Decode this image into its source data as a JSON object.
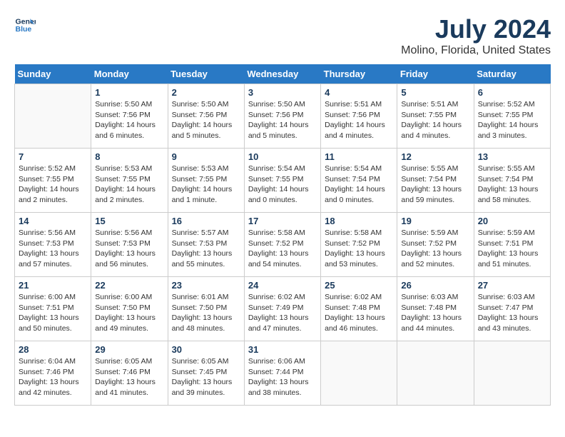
{
  "header": {
    "logo_line1": "General",
    "logo_line2": "Blue",
    "title": "July 2024",
    "subtitle": "Molino, Florida, United States"
  },
  "days_of_week": [
    "Sunday",
    "Monday",
    "Tuesday",
    "Wednesday",
    "Thursday",
    "Friday",
    "Saturday"
  ],
  "weeks": [
    [
      {
        "day": "",
        "info": ""
      },
      {
        "day": "1",
        "info": "Sunrise: 5:50 AM\nSunset: 7:56 PM\nDaylight: 14 hours\nand 6 minutes."
      },
      {
        "day": "2",
        "info": "Sunrise: 5:50 AM\nSunset: 7:56 PM\nDaylight: 14 hours\nand 5 minutes."
      },
      {
        "day": "3",
        "info": "Sunrise: 5:50 AM\nSunset: 7:56 PM\nDaylight: 14 hours\nand 5 minutes."
      },
      {
        "day": "4",
        "info": "Sunrise: 5:51 AM\nSunset: 7:56 PM\nDaylight: 14 hours\nand 4 minutes."
      },
      {
        "day": "5",
        "info": "Sunrise: 5:51 AM\nSunset: 7:55 PM\nDaylight: 14 hours\nand 4 minutes."
      },
      {
        "day": "6",
        "info": "Sunrise: 5:52 AM\nSunset: 7:55 PM\nDaylight: 14 hours\nand 3 minutes."
      }
    ],
    [
      {
        "day": "7",
        "info": "Sunrise: 5:52 AM\nSunset: 7:55 PM\nDaylight: 14 hours\nand 2 minutes."
      },
      {
        "day": "8",
        "info": "Sunrise: 5:53 AM\nSunset: 7:55 PM\nDaylight: 14 hours\nand 2 minutes."
      },
      {
        "day": "9",
        "info": "Sunrise: 5:53 AM\nSunset: 7:55 PM\nDaylight: 14 hours\nand 1 minute."
      },
      {
        "day": "10",
        "info": "Sunrise: 5:54 AM\nSunset: 7:55 PM\nDaylight: 14 hours\nand 0 minutes."
      },
      {
        "day": "11",
        "info": "Sunrise: 5:54 AM\nSunset: 7:54 PM\nDaylight: 14 hours\nand 0 minutes."
      },
      {
        "day": "12",
        "info": "Sunrise: 5:55 AM\nSunset: 7:54 PM\nDaylight: 13 hours\nand 59 minutes."
      },
      {
        "day": "13",
        "info": "Sunrise: 5:55 AM\nSunset: 7:54 PM\nDaylight: 13 hours\nand 58 minutes."
      }
    ],
    [
      {
        "day": "14",
        "info": "Sunrise: 5:56 AM\nSunset: 7:53 PM\nDaylight: 13 hours\nand 57 minutes."
      },
      {
        "day": "15",
        "info": "Sunrise: 5:56 AM\nSunset: 7:53 PM\nDaylight: 13 hours\nand 56 minutes."
      },
      {
        "day": "16",
        "info": "Sunrise: 5:57 AM\nSunset: 7:53 PM\nDaylight: 13 hours\nand 55 minutes."
      },
      {
        "day": "17",
        "info": "Sunrise: 5:58 AM\nSunset: 7:52 PM\nDaylight: 13 hours\nand 54 minutes."
      },
      {
        "day": "18",
        "info": "Sunrise: 5:58 AM\nSunset: 7:52 PM\nDaylight: 13 hours\nand 53 minutes."
      },
      {
        "day": "19",
        "info": "Sunrise: 5:59 AM\nSunset: 7:52 PM\nDaylight: 13 hours\nand 52 minutes."
      },
      {
        "day": "20",
        "info": "Sunrise: 5:59 AM\nSunset: 7:51 PM\nDaylight: 13 hours\nand 51 minutes."
      }
    ],
    [
      {
        "day": "21",
        "info": "Sunrise: 6:00 AM\nSunset: 7:51 PM\nDaylight: 13 hours\nand 50 minutes."
      },
      {
        "day": "22",
        "info": "Sunrise: 6:00 AM\nSunset: 7:50 PM\nDaylight: 13 hours\nand 49 minutes."
      },
      {
        "day": "23",
        "info": "Sunrise: 6:01 AM\nSunset: 7:50 PM\nDaylight: 13 hours\nand 48 minutes."
      },
      {
        "day": "24",
        "info": "Sunrise: 6:02 AM\nSunset: 7:49 PM\nDaylight: 13 hours\nand 47 minutes."
      },
      {
        "day": "25",
        "info": "Sunrise: 6:02 AM\nSunset: 7:48 PM\nDaylight: 13 hours\nand 46 minutes."
      },
      {
        "day": "26",
        "info": "Sunrise: 6:03 AM\nSunset: 7:48 PM\nDaylight: 13 hours\nand 44 minutes."
      },
      {
        "day": "27",
        "info": "Sunrise: 6:03 AM\nSunset: 7:47 PM\nDaylight: 13 hours\nand 43 minutes."
      }
    ],
    [
      {
        "day": "28",
        "info": "Sunrise: 6:04 AM\nSunset: 7:46 PM\nDaylight: 13 hours\nand 42 minutes."
      },
      {
        "day": "29",
        "info": "Sunrise: 6:05 AM\nSunset: 7:46 PM\nDaylight: 13 hours\nand 41 minutes."
      },
      {
        "day": "30",
        "info": "Sunrise: 6:05 AM\nSunset: 7:45 PM\nDaylight: 13 hours\nand 39 minutes."
      },
      {
        "day": "31",
        "info": "Sunrise: 6:06 AM\nSunset: 7:44 PM\nDaylight: 13 hours\nand 38 minutes."
      },
      {
        "day": "",
        "info": ""
      },
      {
        "day": "",
        "info": ""
      },
      {
        "day": "",
        "info": ""
      }
    ]
  ]
}
